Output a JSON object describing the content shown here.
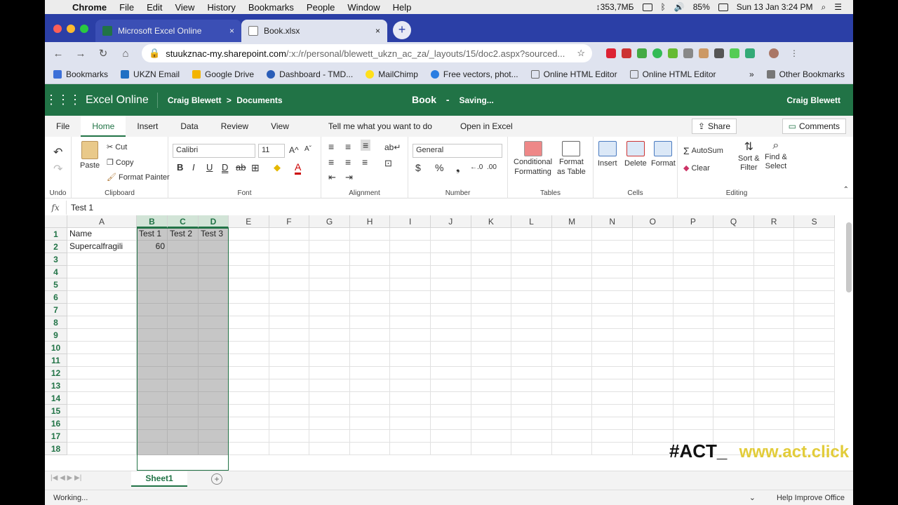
{
  "mac": {
    "menu": [
      "Chrome",
      "File",
      "Edit",
      "View",
      "History",
      "Bookmarks",
      "People",
      "Window",
      "Help"
    ],
    "net": "↕353,7МБ",
    "battery": "85%",
    "clock": "Sun 13 Jan  3:24 PM"
  },
  "browser": {
    "tabs": [
      {
        "title": "Microsoft Excel Online",
        "close": "×"
      },
      {
        "title": "Book.xlsx",
        "close": "×"
      }
    ],
    "new_tab": "+",
    "url_host": "stuukznac-my.sharepoint.com",
    "url_path": "/:x:/r/personal/blewett_ukzn_ac_za/_layouts/15/doc2.aspx?sourced...",
    "bookmarks": [
      "Bookmarks",
      "UKZN Email",
      "Google Drive",
      "Dashboard - TMD...",
      "MailChimp",
      "Free vectors, phot...",
      "Online HTML Editor",
      "Online HTML Editor"
    ],
    "more": "»",
    "other_bookmarks": "Other Bookmarks"
  },
  "excel": {
    "app_name": "Excel Online",
    "breadcrumb_user": "Craig Blewett",
    "breadcrumb_sep": ">",
    "breadcrumb_folder": "Documents",
    "doc_title": "Book",
    "doc_sep": "-",
    "doc_status": "Saving...",
    "user_name": "Craig Blewett",
    "ribbon_tabs": [
      "File",
      "Home",
      "Insert",
      "Data",
      "Review",
      "View",
      "Tell me what you want to do",
      "Open in Excel"
    ],
    "share": "Share",
    "comments": "Comments",
    "groups": {
      "undo": "Undo",
      "clipboard": "Clipboard",
      "font": "Font",
      "alignment": "Alignment",
      "number": "Number",
      "tables": "Tables",
      "cells": "Cells",
      "editing": "Editing"
    },
    "clip": {
      "paste": "Paste",
      "cut": "Cut",
      "copy": "Copy",
      "format_painter": "Format Painter"
    },
    "font_name": "Calibri",
    "font_size": "11",
    "number_format": "General",
    "tables": {
      "cond_format_1": "Conditional",
      "cond_format_2": "Formatting",
      "fmt_table_1": "Format",
      "fmt_table_2": "as Table"
    },
    "cells": {
      "insert": "Insert",
      "delete": "Delete",
      "format": "Format"
    },
    "editing": {
      "autosum": "AutoSum",
      "clear": "Clear",
      "sort_1": "Sort &",
      "sort_2": "Filter",
      "find_1": "Find &",
      "find_2": "Select"
    },
    "formula_label": "fx",
    "formula_value": "Test 1",
    "columns": [
      "A",
      "B",
      "C",
      "D",
      "E",
      "F",
      "G",
      "H",
      "I",
      "J",
      "K",
      "L",
      "M",
      "N",
      "O",
      "P",
      "Q",
      "R",
      "S"
    ],
    "rows": [
      "1",
      "2",
      "3",
      "4",
      "5",
      "6",
      "7",
      "8",
      "9",
      "10",
      "11",
      "12",
      "13",
      "14",
      "15",
      "16",
      "17",
      "18"
    ],
    "cells_data": {
      "A1": "Name",
      "B1": "Test 1",
      "C1": "Test 2",
      "D1": "Test 3",
      "A2": "Supercalfragili",
      "B2": "60"
    },
    "sheet_name": "Sheet1",
    "status_left": "Working...",
    "status_right": "Help Improve Office"
  },
  "watermark": {
    "hash": "#ACT_",
    "site": "www.act.click"
  },
  "colors": {
    "excel_green": "#217346",
    "tabstrip": "#2b3fa6"
  }
}
